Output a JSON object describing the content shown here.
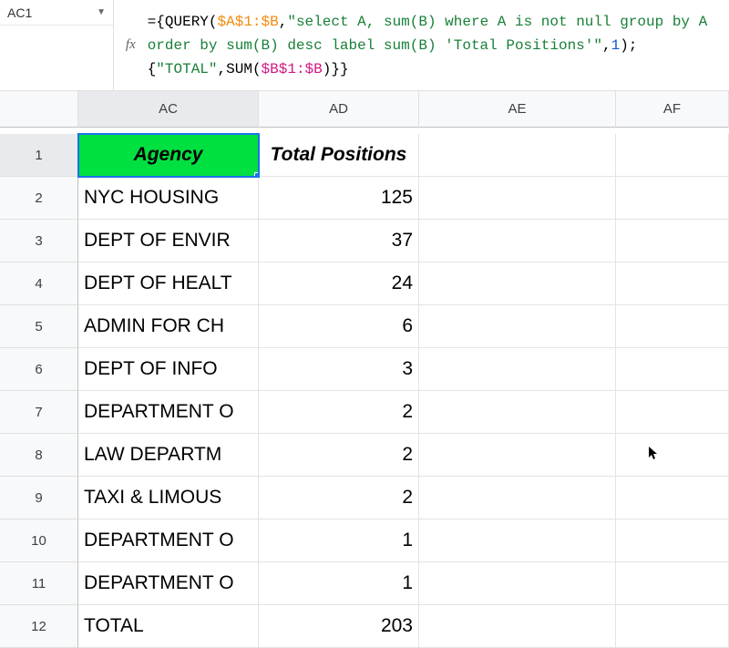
{
  "name_box": "AC1",
  "formula": {
    "prefix": "={",
    "fn1": "QUERY",
    "open1": "(",
    "range1": "$A$1:$B",
    "comma1": ",",
    "str1": "\"select A, sum(B) where A is not null group by A order by sum(B) desc label sum(B) 'Total Positions'\"",
    "comma2": ",",
    "num1": "1",
    "close1": ");{",
    "str2": "\"TOTAL\"",
    "comma3": ",",
    "fn2": "SUM",
    "open2": "(",
    "range2": "$B$1:$B",
    "close2": ")}}"
  },
  "columns": [
    "AC",
    "AD",
    "AE",
    "AF"
  ],
  "rows": [
    {
      "n": "1",
      "agency": "Agency",
      "total": "Total Positions",
      "header": true
    },
    {
      "n": "2",
      "agency": "NYC HOUSING",
      "total": "125"
    },
    {
      "n": "3",
      "agency": "DEPT OF ENVIR",
      "total": "37"
    },
    {
      "n": "4",
      "agency": "DEPT OF HEALT",
      "total": "24"
    },
    {
      "n": "5",
      "agency": "ADMIN FOR CH",
      "total": "6"
    },
    {
      "n": "6",
      "agency": "DEPT OF INFO",
      "total": "3"
    },
    {
      "n": "7",
      "agency": "DEPARTMENT O",
      "total": "2"
    },
    {
      "n": "8",
      "agency": "LAW DEPARTM",
      "total": "2"
    },
    {
      "n": "9",
      "agency": "TAXI & LIMOUS",
      "total": "2"
    },
    {
      "n": "10",
      "agency": "DEPARTMENT O",
      "total": "1"
    },
    {
      "n": "11",
      "agency": "DEPARTMENT O",
      "total": "1"
    },
    {
      "n": "12",
      "agency": "TOTAL",
      "total": "203"
    }
  ],
  "fx_label": "fx"
}
